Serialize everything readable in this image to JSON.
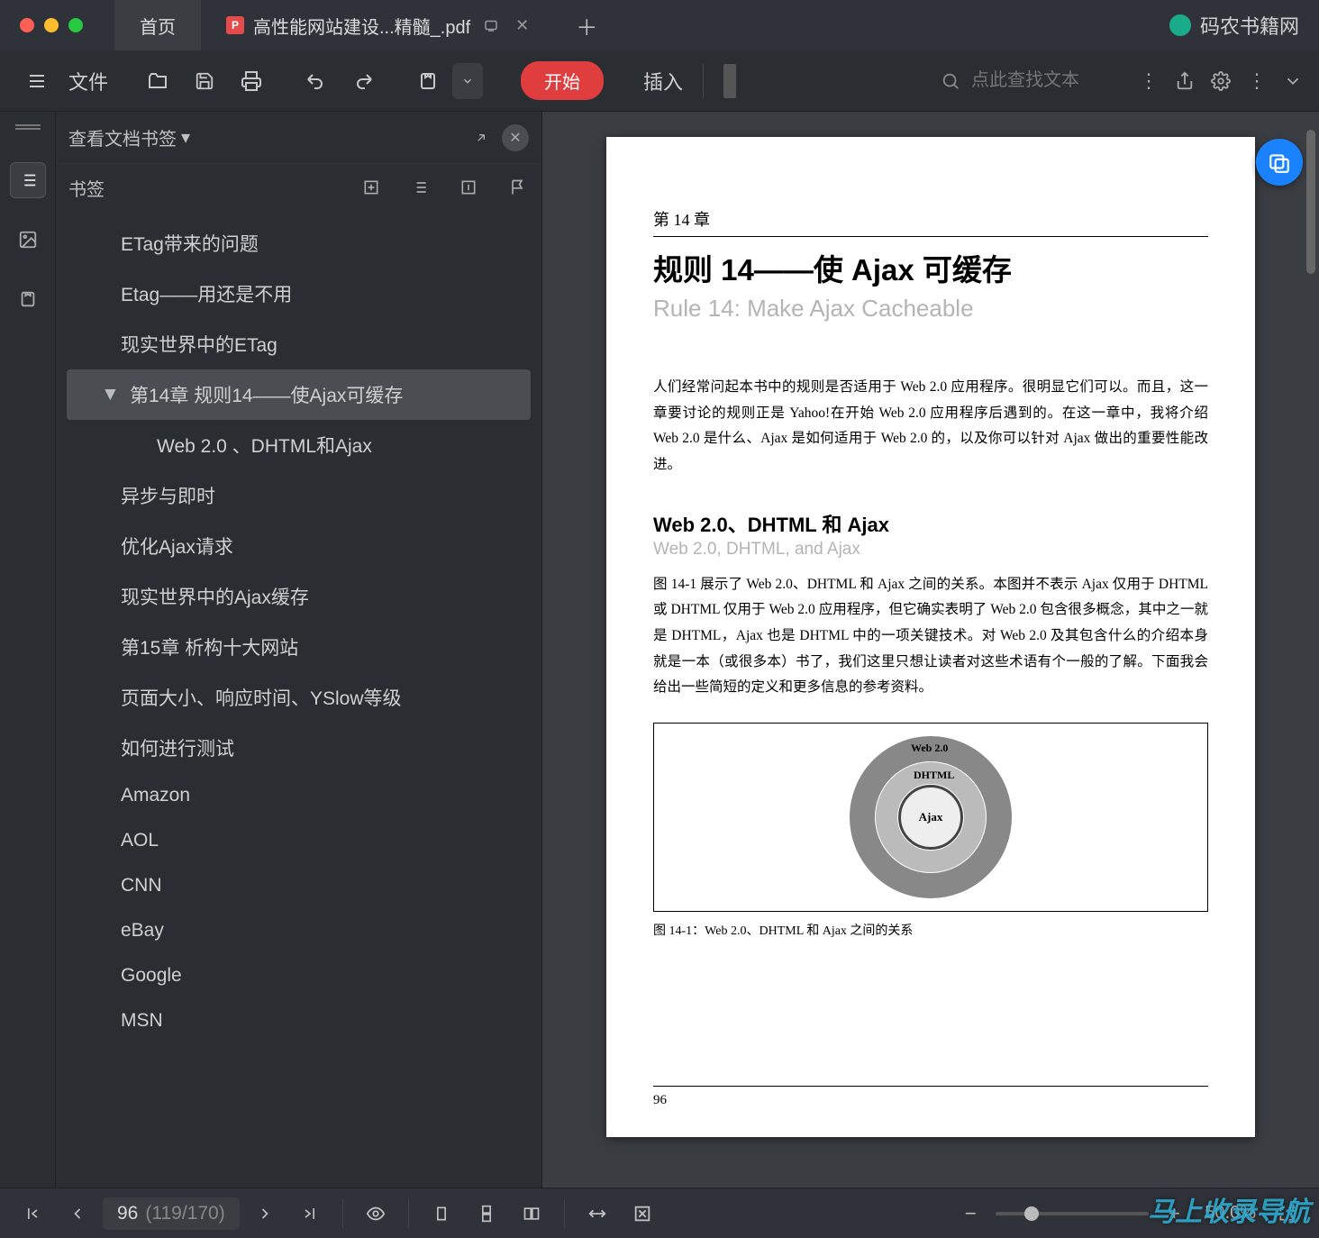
{
  "titlebar": {
    "tab_home": "首页",
    "tab_file": "高性能网站建设...精髓_.pdf",
    "brand": "码农书籍网"
  },
  "toolbar": {
    "file": "文件",
    "start": "开始",
    "insert": "插入",
    "search_placeholder": "点此查找文本"
  },
  "panel": {
    "title": "查看文档书签",
    "tab": "书签"
  },
  "bookmarks": [
    {
      "label": "ETag带来的问题",
      "indent": 1
    },
    {
      "label": "Etag——用还是不用",
      "indent": 1
    },
    {
      "label": "现实世界中的ETag",
      "indent": 1
    },
    {
      "label": "第14章 规则14——使Ajax可缓存",
      "indent": 1,
      "selected": true,
      "expandable": true
    },
    {
      "label": "Web 2.0 、DHTML和Ajax",
      "indent": 2
    },
    {
      "label": "异步与即时",
      "indent": 1
    },
    {
      "label": "优化Ajax请求",
      "indent": 1
    },
    {
      "label": "现实世界中的Ajax缓存",
      "indent": 1
    },
    {
      "label": "第15章 析构十大网站",
      "indent": 1
    },
    {
      "label": "页面大小、响应时间、YSlow等级",
      "indent": 1
    },
    {
      "label": "如何进行测试",
      "indent": 1
    },
    {
      "label": "Amazon",
      "indent": 1
    },
    {
      "label": "AOL",
      "indent": 1
    },
    {
      "label": "CNN",
      "indent": 1
    },
    {
      "label": "eBay",
      "indent": 1
    },
    {
      "label": "Google",
      "indent": 1
    },
    {
      "label": "MSN",
      "indent": 1
    }
  ],
  "page": {
    "chapter": "第 14 章",
    "h1": "规则 14——使 Ajax 可缓存",
    "sub": "Rule 14: Make Ajax Cacheable",
    "para1": "人们经常问起本书中的规则是否适用于 Web 2.0 应用程序。很明显它们可以。而且，这一章要讨论的规则正是 Yahoo!在开始 Web 2.0 应用程序后遇到的。在这一章中，我将介绍 Web 2.0 是什么、Ajax 是如何适用于 Web 2.0 的，以及你可以针对 Ajax 做出的重要性能改进。",
    "h2": "Web 2.0、DHTML 和 Ajax",
    "sub2": "Web 2.0, DHTML, and Ajax",
    "para2": "图 14-1 展示了 Web 2.0、DHTML 和 Ajax 之间的关系。本图并不表示 Ajax 仅用于 DHTML 或 DHTML 仅用于 Web 2.0 应用程序，但它确实表明了 Web 2.0 包含很多概念，其中之一就是 DHTML，Ajax 也是 DHTML 中的一项关键技术。对 Web 2.0 及其包含什么的介绍本身就是一本（或很多本）书了，我们这里只想让读者对这些术语有个一般的了解。下面我会给出一些简短的定义和更多信息的参考资料。",
    "fig_outer": "Web 2.0",
    "fig_mid": "DHTML",
    "fig_inner": "Ajax",
    "figcap": "图 14-1：Web 2.0、DHTML 和 Ajax 之间的关系",
    "pagenum": "96"
  },
  "status": {
    "page_current": "96",
    "page_phys": "(119/170)",
    "zoom": "50.0%"
  },
  "watermark": "马上收录导航"
}
